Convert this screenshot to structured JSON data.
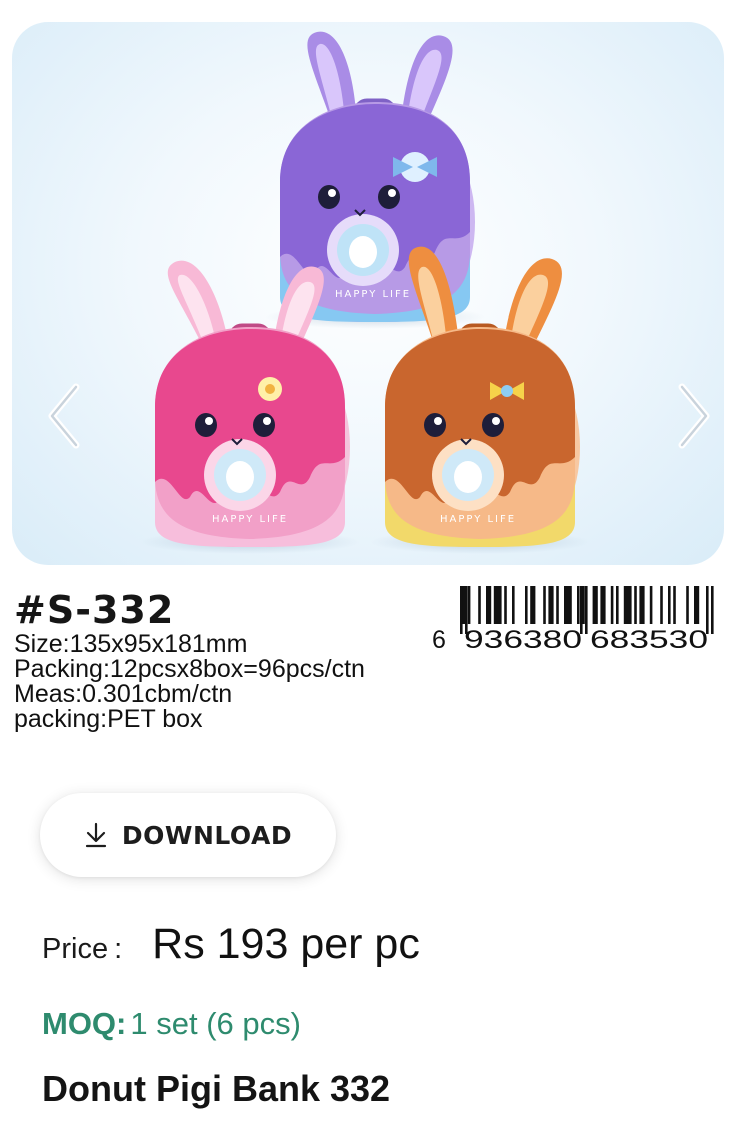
{
  "gallery": {
    "prev_icon": "chevron-left-icon",
    "next_icon": "chevron-right-icon",
    "products": [
      {
        "name": "purple",
        "body": "#b79ae6",
        "icing": "#8a66d6",
        "ear": "#a98ce6",
        "bottom": "#86c8f2"
      },
      {
        "name": "pink",
        "body": "#f2a0c8",
        "icing": "#e8488e",
        "ear": "#f8b9d6",
        "bottom": "#f7bedc"
      },
      {
        "name": "orange",
        "body": "#f6b988",
        "icing": "#c9662e",
        "ear": "#ee8e40",
        "bottom": "#f2d96a"
      }
    ],
    "band_text": "HAPPY LIFE"
  },
  "spec": {
    "sku": "#S-332",
    "size": "Size:135x95x181mm",
    "packing": "Packing:12pcsx8box=96pcs/ctn",
    "meas": "Meas:0.301cbm/ctn",
    "packing_type": "packing:PET box"
  },
  "barcode": {
    "prefix": "6",
    "left_group": "936380",
    "right_group": "683530"
  },
  "download": {
    "label": "DOWNLOAD",
    "icon": "download-icon"
  },
  "price": {
    "label": "Price",
    "colon": ":",
    "value": "Rs 193 per pc"
  },
  "moq": {
    "label": "MOQ:",
    "value": "1 set (6 pcs)",
    "color": "#2e8b6e"
  },
  "product": {
    "name": "Donut Pigi Bank 332"
  }
}
